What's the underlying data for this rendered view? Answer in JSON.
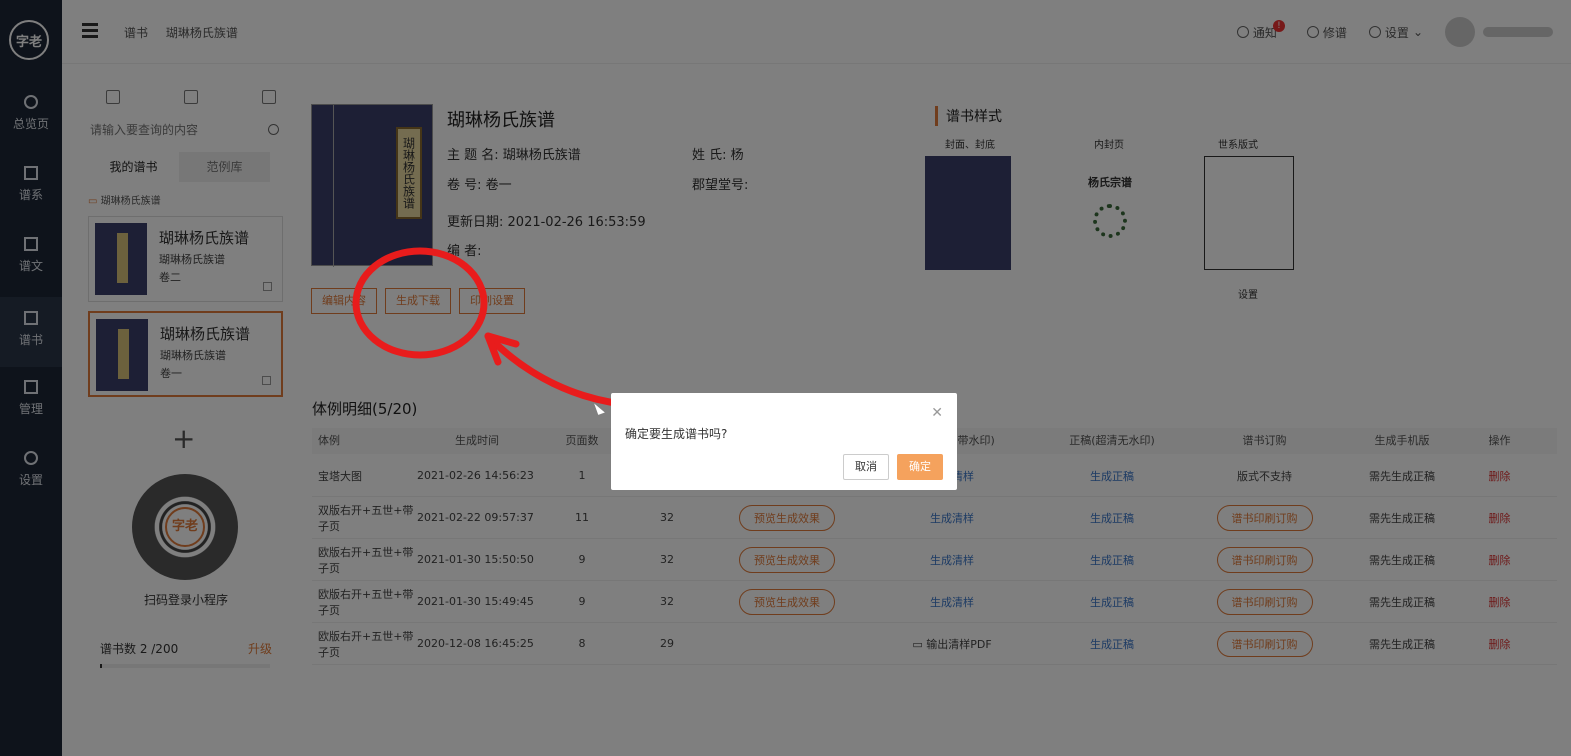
{
  "nav": {
    "logo": "字老",
    "items": [
      {
        "label": "总览页"
      },
      {
        "label": "谱系"
      },
      {
        "label": "谱文"
      },
      {
        "label": "谱书"
      },
      {
        "label": "管理"
      },
      {
        "label": "设置"
      }
    ]
  },
  "topbar": {
    "crumb1": "谱书",
    "crumb2": "瑚琳杨氏族谱",
    "notify": "通知",
    "notify_badge": "!",
    "edit": "修谱",
    "settings": "设置"
  },
  "side": {
    "search_placeholder": "请输入要查询的内容",
    "tab_mine": "我的谱书",
    "tab_lib": "范例库",
    "folder": "瑚琳杨氏族谱",
    "cards": [
      {
        "title": "瑚琳杨氏族谱",
        "sub": "瑚琳杨氏族谱",
        "vol": "卷二"
      },
      {
        "title": "瑚琳杨氏族谱",
        "sub": "瑚琳杨氏族谱",
        "vol": "卷一"
      }
    ],
    "qr_label": "扫码登录小程序",
    "count_label": "谱书数 2 /200",
    "upgrade": "升级",
    "count_fraction": 0.01
  },
  "book": {
    "cover_label": "瑚琳杨氏族谱",
    "title": "瑚琳杨氏族谱",
    "subject_label": "主 题 名:",
    "subject": "瑚琳杨氏族谱",
    "surname_label": "姓      氏:",
    "surname": "杨",
    "volume_label": "卷      号:",
    "volume": "卷一",
    "hall_label": "郡望堂号:",
    "hall": "",
    "date_label": "更新日期:",
    "date": "2021-02-26 16:53:59",
    "editor_label": "编      者:",
    "editor": "",
    "btn_edit": "编辑内容",
    "btn_gen": "生成下载",
    "btn_set": "印刷设置"
  },
  "style": {
    "title": "谱书样式",
    "cover_label": "封面、封底",
    "inner_label": "内封页",
    "tree_label": "世系版式",
    "inner_title": "杨氏宗谱",
    "settings": "设置"
  },
  "table": {
    "title": "体例明细(5/20)",
    "headers": [
      "体例",
      "生成时间",
      "页面数",
      "",
      "",
      "清样(标清带水印)",
      "正稿(超清无水印)",
      "谱书订购",
      "生成手机版",
      "操作"
    ],
    "rows": [
      {
        "style": "宝塔大图",
        "time": "2021-02-26 14:56:23",
        "pages": "1",
        "n": "",
        "preview": "",
        "draft": "生成清样",
        "final": "生成正稿",
        "order": "版式不支持",
        "mobile": "需先生成正稿",
        "op": "删除"
      },
      {
        "style": "双版右开+五世+带子页",
        "time": "2021-02-22 09:57:37",
        "pages": "11",
        "n": "32",
        "preview": "预览生成效果",
        "draft": "生成清样",
        "final": "生成正稿",
        "order": "谱书印刷订购",
        "mobile": "需先生成正稿",
        "op": "删除"
      },
      {
        "style": "欧版右开+五世+带子页",
        "time": "2021-01-30 15:50:50",
        "pages": "9",
        "n": "32",
        "preview": "预览生成效果",
        "draft": "生成清样",
        "final": "生成正稿",
        "order": "谱书印刷订购",
        "mobile": "需先生成正稿",
        "op": "删除"
      },
      {
        "style": "欧版右开+五世+带子页",
        "time": "2021-01-30 15:49:45",
        "pages": "9",
        "n": "32",
        "preview": "预览生成效果",
        "draft": "生成清样",
        "final": "生成正稿",
        "order": "谱书印刷订购",
        "mobile": "需先生成正稿",
        "op": "删除"
      },
      {
        "style": "欧版右开+五世+带子页",
        "time": "2020-12-08 16:45:25",
        "pages": "8",
        "n": "29",
        "preview": "",
        "draft": "输出清样PDF",
        "final": "生成正稿",
        "order": "谱书印刷订购",
        "mobile": "需先生成正稿",
        "op": "删除"
      }
    ]
  },
  "dialog": {
    "message": "确定要生成谱书吗?",
    "cancel": "取消",
    "ok": "确定"
  },
  "colors": {
    "accent": "#e07b3a",
    "nav_bg": "#1d2736",
    "annotation": "#e81c1c"
  }
}
